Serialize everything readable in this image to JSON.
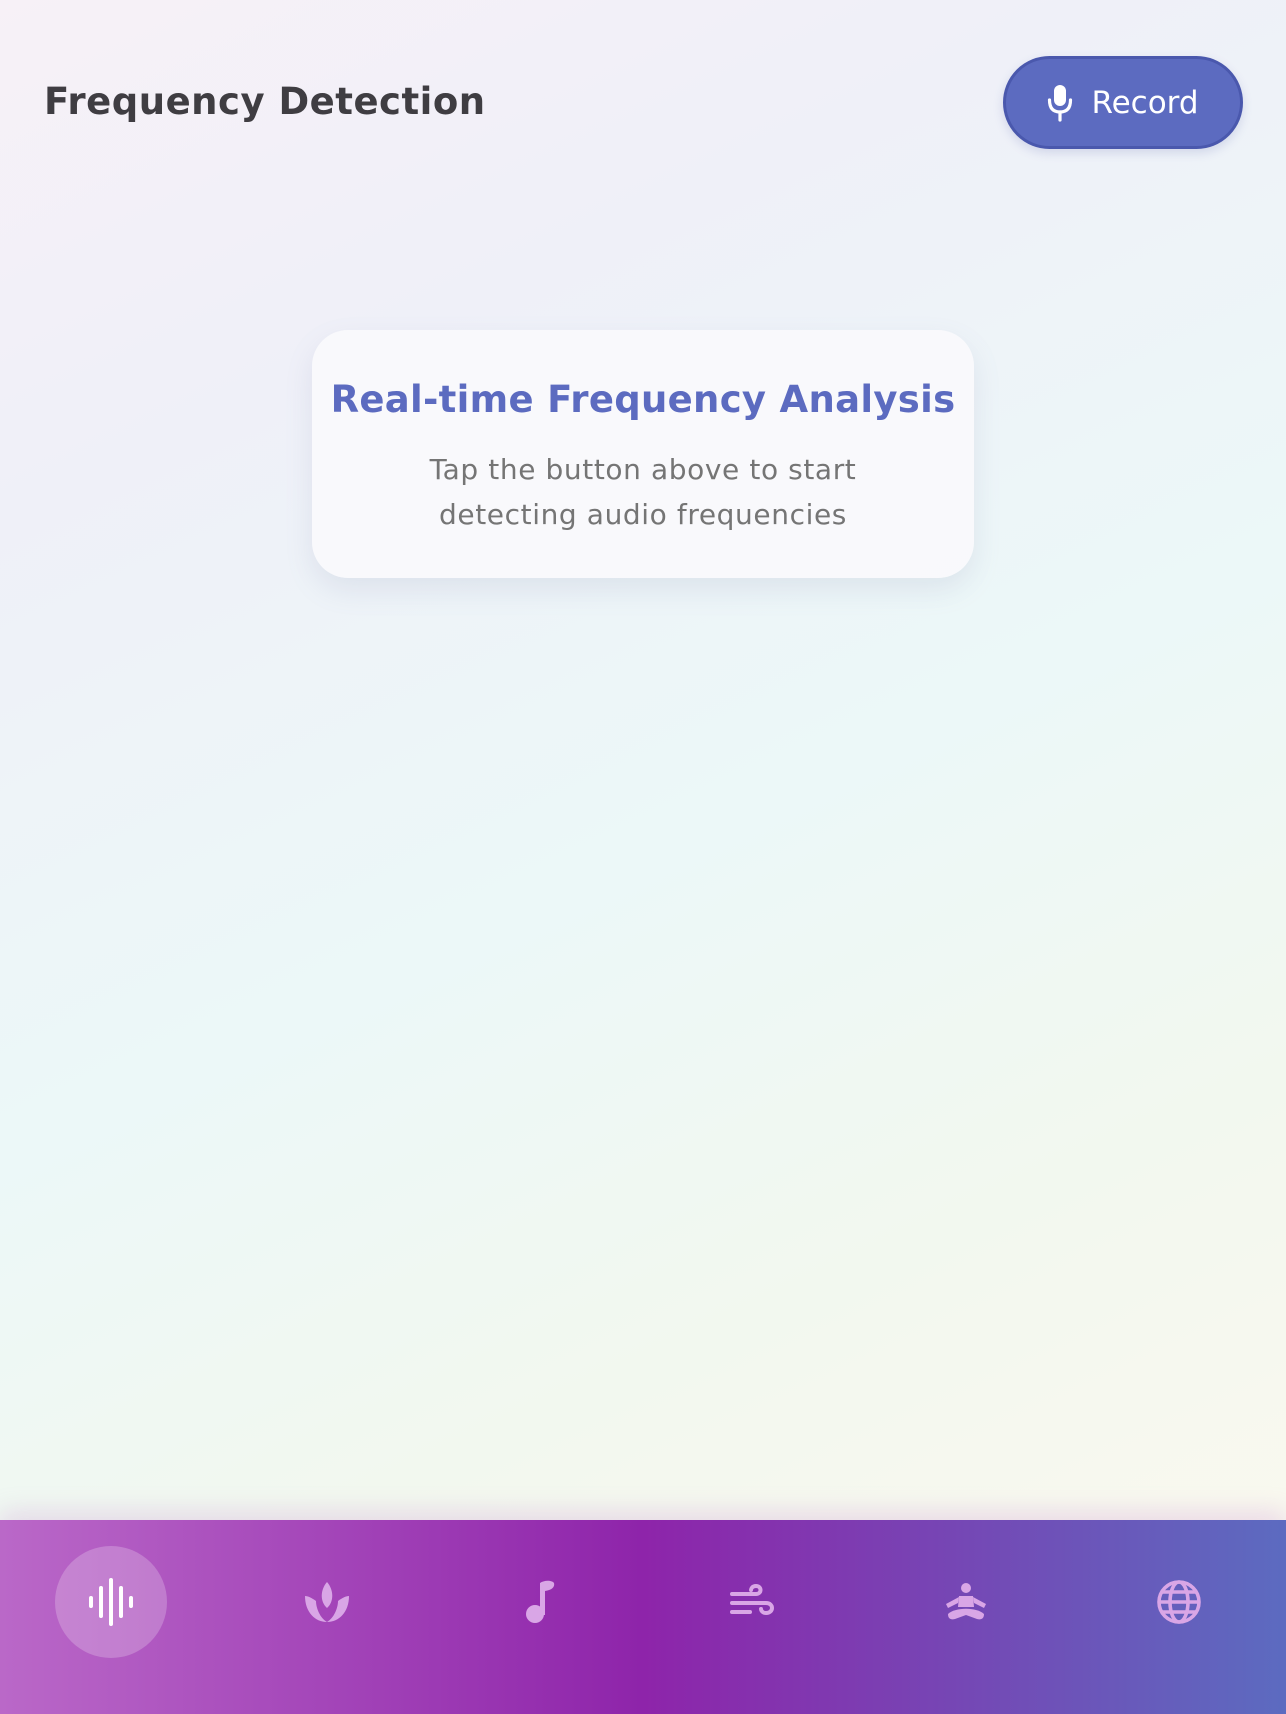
{
  "header": {
    "title": "Frequency Detection",
    "record_button": {
      "label": "Record",
      "icon": "microphone-icon"
    }
  },
  "info_card": {
    "title": "Real-time Frequency Analysis",
    "description": "Tap the button above to start detecting audio frequencies"
  },
  "bottom_nav": {
    "active_index": 0,
    "items": [
      {
        "icon": "waveform-icon",
        "active": true
      },
      {
        "icon": "lotus-icon",
        "active": false
      },
      {
        "icon": "music-note-icon",
        "active": false
      },
      {
        "icon": "wind-icon",
        "active": false
      },
      {
        "icon": "meditation-icon",
        "active": false
      },
      {
        "icon": "globe-icon",
        "active": false
      }
    ]
  },
  "colors": {
    "accent": "#5c6bc0",
    "title_text": "#3f3d42",
    "body_text": "#757575",
    "nav_gradient_start": "#ba68c8",
    "nav_gradient_mid": "#8e24aa",
    "nav_gradient_end": "#5c6bc0",
    "nav_icon_inactive": "#d9a6e6"
  }
}
